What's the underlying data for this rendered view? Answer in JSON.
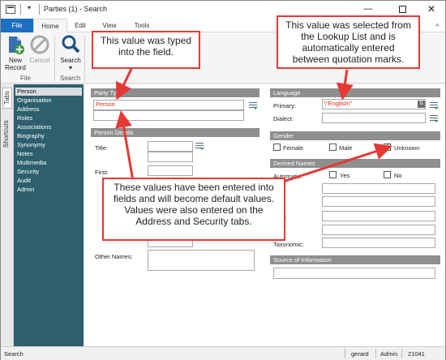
{
  "window": {
    "title": "Parties (1) - Search",
    "controls": {
      "minimize": "—",
      "close": "✕"
    }
  },
  "ribbon": {
    "tabs": [
      "File",
      "Home",
      "Edit",
      "View",
      "Tools"
    ],
    "groups": {
      "file": {
        "label": "File",
        "buttons": [
          {
            "label1": "New",
            "label2": "Record",
            "icon": "new-record-icon"
          },
          {
            "label1": "Cancel",
            "label2": "",
            "icon": "cancel-icon"
          }
        ]
      },
      "search": {
        "label": "Search",
        "buttons": [
          {
            "label1": "Search",
            "label2": "▾",
            "icon": "search-icon"
          }
        ]
      }
    }
  },
  "side_tabs": {
    "tabs": "Tabs",
    "shortcuts": "Shortcuts"
  },
  "nav": {
    "items": [
      "Person",
      "Organisation",
      "Address",
      "Roles",
      "Associations",
      "Biography",
      "Synonymy",
      "Notes",
      "Multimedia",
      "Security",
      "Audit",
      "Admin"
    ],
    "selected_index": 0
  },
  "form": {
    "party_type": {
      "header": "Party Type",
      "value": "Person"
    },
    "person_details": {
      "header": "Person Details",
      "title_label": "Title:",
      "first_label": "First:",
      "other_names_label": "Other Names:"
    },
    "language": {
      "header": "Language",
      "primary_label": "Primary:",
      "primary_value": "\\\"English\\\"",
      "dialect_label": "Dialect:"
    },
    "gender": {
      "header": "Gender",
      "options": [
        {
          "label": "Female",
          "checked": false
        },
        {
          "label": "Male",
          "checked": false
        },
        {
          "label": "Unknown",
          "checked": true
        }
      ]
    },
    "derived_names": {
      "header": "Derived Names",
      "automatic_label": "Automatic:",
      "yes_label": "Yes",
      "no_label": "No",
      "partial_label": "e:",
      "taxonomic_label": "Taxonomic:"
    },
    "source": {
      "header": "Source of Information"
    }
  },
  "status_bar": {
    "mode": "Search",
    "user": "gerard",
    "role": "Admin",
    "record": "21041"
  },
  "callouts": {
    "typed": "This value was typed into the field.",
    "lookup": "This value was selected from the Lookup List and is automatically entered between quotation marks.",
    "defaults": "These values have been entered into fields and will become default values. Values were also entered on the Address and Security tabs."
  },
  "colors": {
    "accent": "#1e6fc2",
    "nav_bg": "#2d5f6e",
    "callout_border": "#e53935",
    "entered_value": "#e0261c"
  }
}
